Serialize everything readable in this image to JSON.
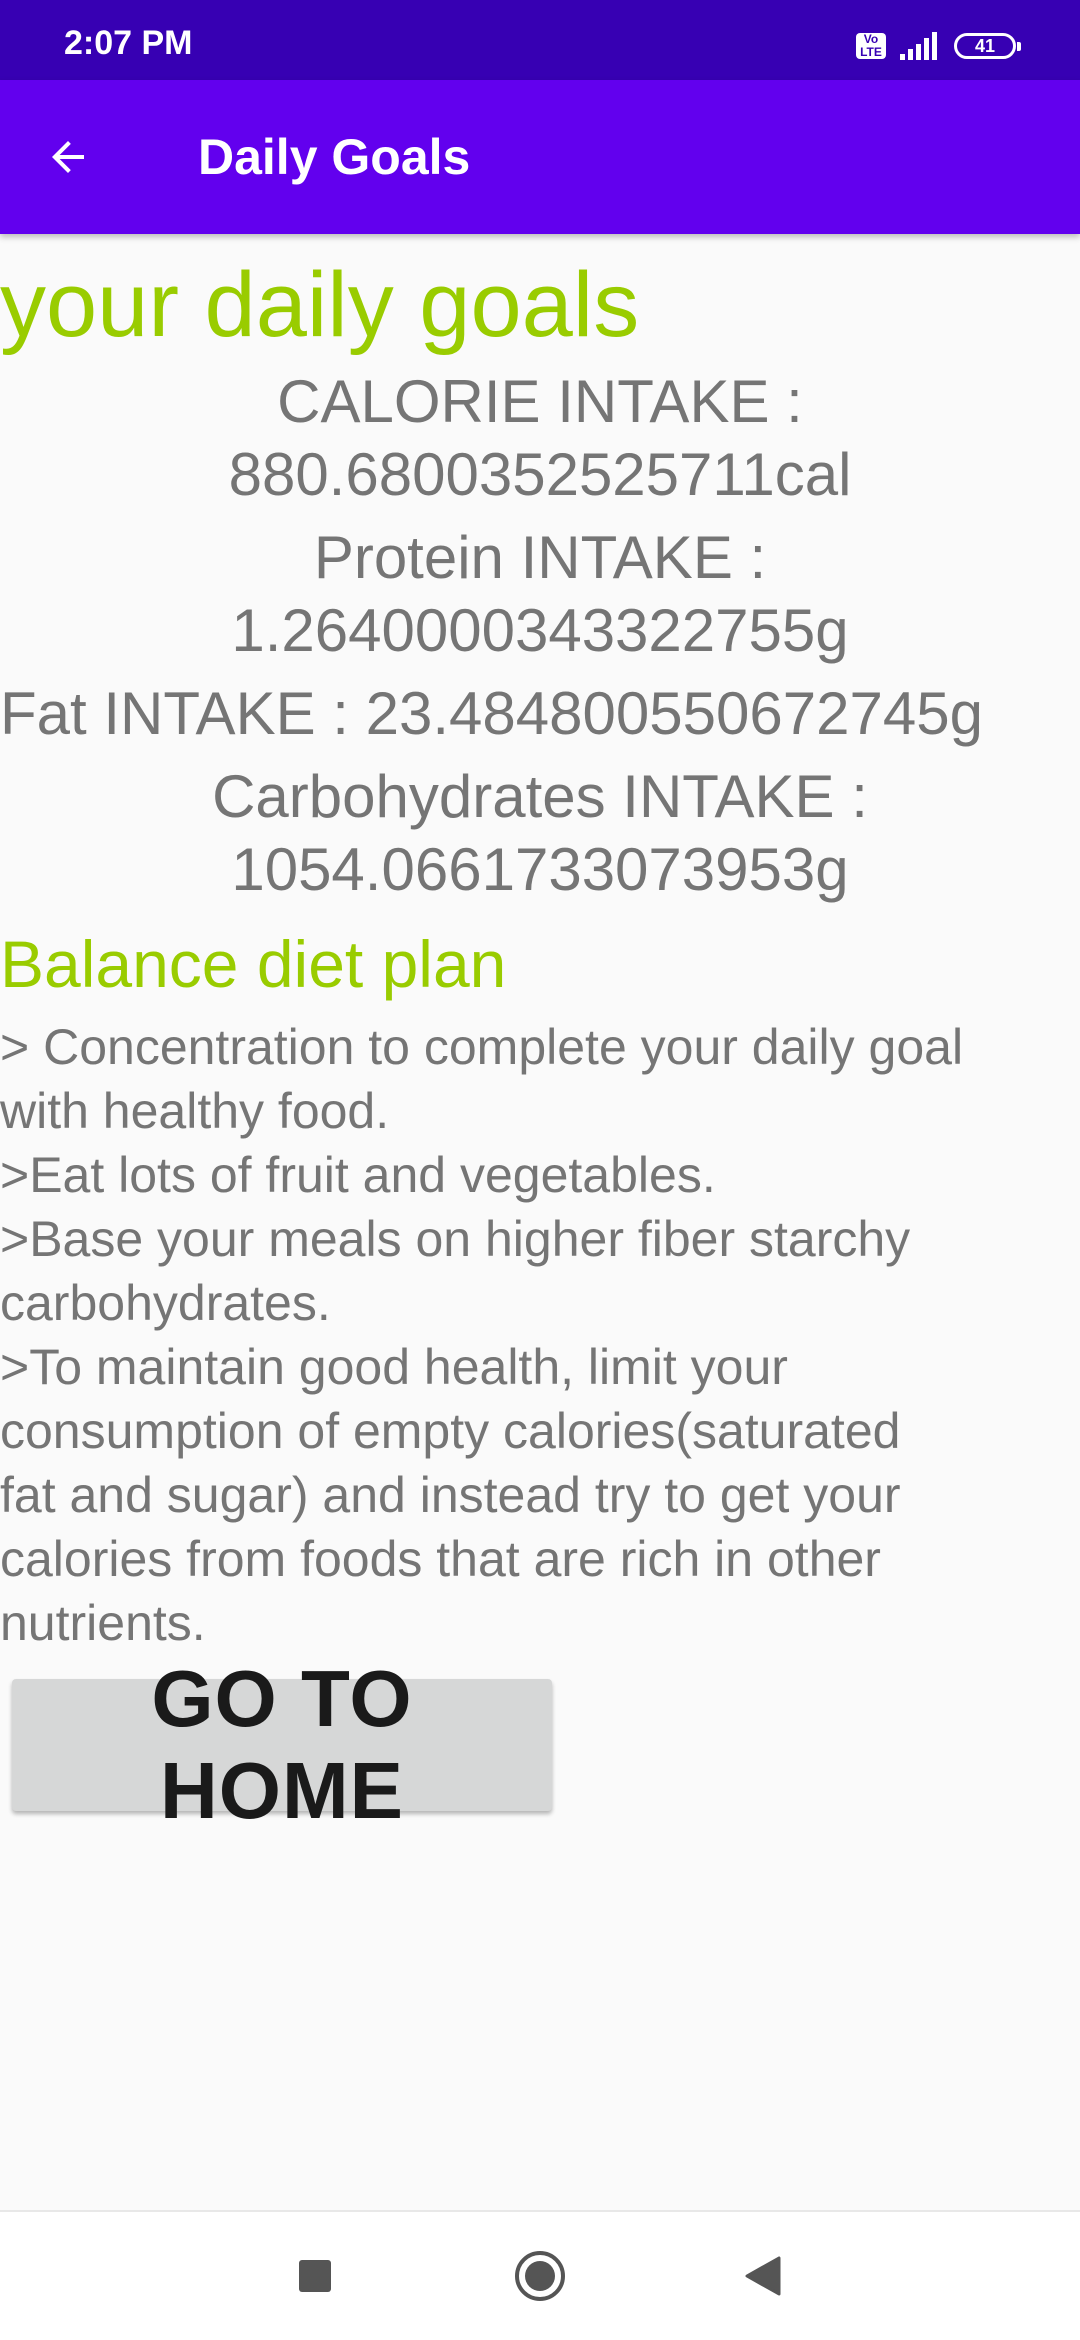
{
  "status_bar": {
    "time": "2:07 PM",
    "volte_label": "Vo\nLTE",
    "battery_level": "41",
    "icons": [
      "volte-icon",
      "signal-icon",
      "battery-icon"
    ]
  },
  "app_bar": {
    "back_icon": "arrow-back-icon",
    "title": "Daily Goals"
  },
  "main": {
    "heading": "your daily goals",
    "calorie": {
      "label": "CALORIE INTAKE :",
      "value": "880.6800352525711cal"
    },
    "protein": {
      "label": "Protein INTAKE :",
      "value": "1.2640000343322755g"
    },
    "fat": {
      "text": "Fat INTAKE : 23.484800550672745g"
    },
    "carbohydrates": {
      "label": "Carbohydrates INTAKE :",
      "value": "1054.0661733073953g"
    },
    "plan_heading": "Balance diet plan",
    "plan_lines": [
      "> Concentration to complete your daily goal",
      "with healthy food.",
      " >Eat lots of fruit and vegetables.",
      " >Base your meals on higher fiber starchy",
      "carbohydrates.",
      " >To maintain good health, limit your",
      "consumption of empty calories(saturated",
      "fat and sugar) and instead try to get your",
      "calories from foods that are rich in other",
      "nutrients."
    ],
    "home_button_label": "GO TO HOME"
  },
  "nav_bar": {
    "icons": [
      "recents-square-icon",
      "home-circle-icon",
      "back-triangle-icon"
    ]
  },
  "colors": {
    "status_bar": "#3700b3",
    "app_bar": "#6200ee",
    "accent_green": "#99cc00",
    "body_text": "#757575",
    "button_bg": "#d6d7d7",
    "background": "#fafafa"
  }
}
